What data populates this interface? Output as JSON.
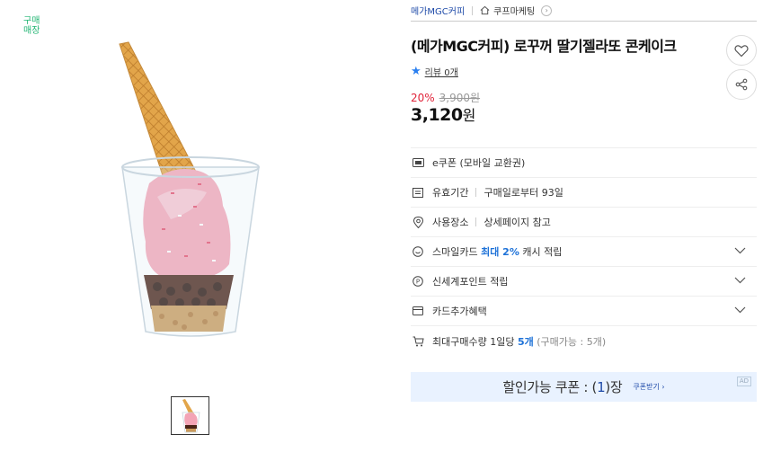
{
  "badge": "구매 매장",
  "breadcrumb": {
    "seller": "메가MGC커피",
    "store": "쿠프마케팅"
  },
  "product": {
    "title": "(메가MGC커피) 로꾸꺼 딸기젤라또 콘케이크",
    "review_text": "리뷰 0개",
    "discount_rate": "20%",
    "original_price": "3,900원",
    "price_number": "3,120",
    "price_unit": "원"
  },
  "info": {
    "ecoupon": "e쿠폰 (모바일 교환권)",
    "validity_label": "유효기간",
    "validity_value": "구매일로부터 93일",
    "place_label": "사용장소",
    "place_value": "상세페이지 참고",
    "smile_prefix": "스마일카드",
    "smile_highlight": "최대 2%",
    "smile_suffix": "캐시 적립",
    "shinsegae": "신세계포인트 적립",
    "card_benefit": "카드추가혜택",
    "max_prefix": "최대구매수량 1일당",
    "max_highlight": "5개",
    "max_note": "(구매가능 : 5개)"
  },
  "coupon": {
    "text_prefix": "할인가능 쿠폰 : (",
    "count": "1",
    "text_suffix": ")장",
    "link": "쿠폰받기 ›",
    "ad": "AD"
  },
  "icons": {
    "heart": "heart-icon",
    "share": "share-icon",
    "star": "star-icon",
    "home": "home-icon",
    "chevron": "chevron-down-icon"
  },
  "colors": {
    "accent_blue": "#1e72d8",
    "discount_red": "#e0243a",
    "badge_green": "#22b573",
    "coupon_bg": "#e9f2ff"
  }
}
